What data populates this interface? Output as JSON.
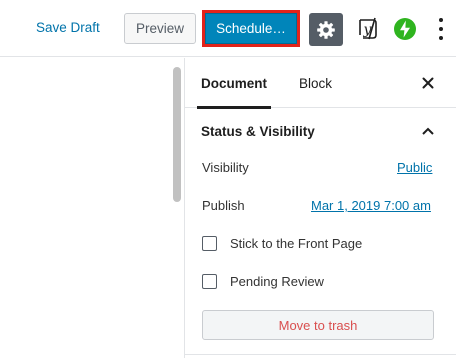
{
  "toolbar": {
    "save_draft_label": "Save Draft",
    "preview_label": "Preview",
    "schedule_label": "Schedule…",
    "settings_icon": "gear-icon",
    "yoast_icon": "yoast-icon",
    "yoast_glyph": "y",
    "jetpack_icon": "jetpack-icon",
    "more_icon": "more-vertical-icon"
  },
  "sidebar": {
    "tabs": [
      {
        "label": "Document",
        "active": true
      },
      {
        "label": "Block",
        "active": false
      }
    ],
    "close_icon": "close-icon",
    "close_glyph": "✕",
    "panel": {
      "title": "Status & Visibility",
      "expanded": true,
      "visibility_label": "Visibility",
      "visibility_value": "Public",
      "publish_label": "Publish",
      "publish_value": "Mar 1, 2019 7:00 am",
      "options": [
        {
          "label": "Stick to the Front Page",
          "checked": false
        },
        {
          "label": "Pending Review",
          "checked": false
        }
      ],
      "trash_label": "Move to trash"
    }
  },
  "colors": {
    "accent": "#0085ba",
    "link": "#0073aa",
    "highlight_border": "#e2231a",
    "danger": "#d94f4f",
    "jetpack": "#2fb41f"
  }
}
